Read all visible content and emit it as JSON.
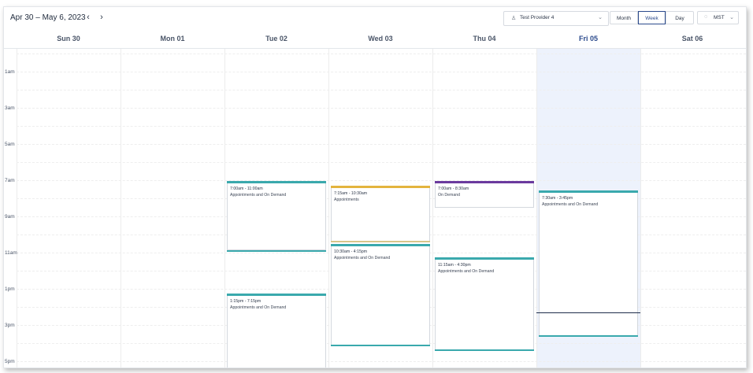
{
  "header": {
    "date_range": "Apr 30 – May 6, 2023",
    "prev_icon": "chevron-left-icon",
    "next_icon": "chevron-right-icon",
    "provider": {
      "icon": "user-icon",
      "label": "Test Provider 4",
      "caret": "chevron-down-icon"
    },
    "views": [
      "Month",
      "Week",
      "Day"
    ],
    "active_view": "Week",
    "timezone": {
      "icon": "globe-icon",
      "label": "MST",
      "caret": "chevron-down-icon"
    }
  },
  "days": [
    "Sun 30",
    "Mon 01",
    "Tue 02",
    "Wed 03",
    "Thu 04",
    "Fri 05",
    "Sat 06"
  ],
  "today": "Fri 05",
  "time_labels": [
    "1am",
    "3am",
    "5am",
    "7am",
    "9am",
    "11am",
    "1pm",
    "3pm",
    "5pm"
  ],
  "colors": {
    "teal": "#3aa9ad",
    "gold": "#e3b43e",
    "purple": "#6b3a9e",
    "today_bg": "#edf2fc",
    "accent": "#2b4a8c"
  },
  "events": [
    {
      "day": "Tue 02",
      "time": "7:00am - 11:00am",
      "desc": "Appointments and On Demand",
      "color": "#3aa9ad"
    },
    {
      "day": "Tue 02",
      "time": "1:15pm - 7:15pm",
      "desc": "Appointments and On Demand",
      "color": "#3aa9ad"
    },
    {
      "day": "Wed 03",
      "time": "7:15am - 10:30am",
      "desc": "Appointments",
      "color": "#e3b43e"
    },
    {
      "day": "Wed 03",
      "time": "10:30am - 4:15pm",
      "desc": "Appointments and On Demand",
      "color": "#3aa9ad"
    },
    {
      "day": "Thu 04",
      "time": "7:00am - 8:30am",
      "desc": "On Demand",
      "color": "#6b3a9e"
    },
    {
      "day": "Thu 04",
      "time": "11:15am - 4:30pm",
      "desc": "Appointments and On Demand",
      "color": "#3aa9ad"
    },
    {
      "day": "Fri 05",
      "time": "7:30am - 3:45pm",
      "desc": "Appointments and On Demand",
      "color": "#3aa9ad"
    }
  ]
}
